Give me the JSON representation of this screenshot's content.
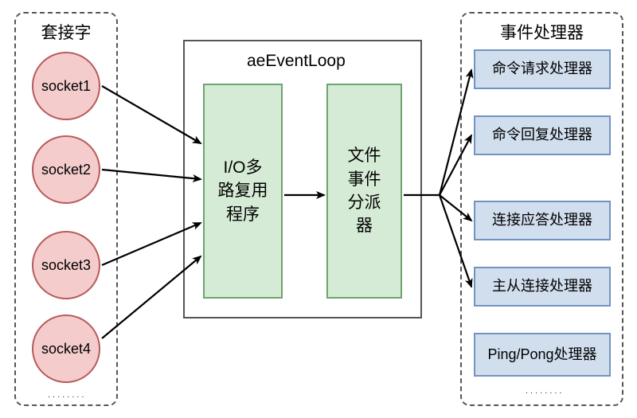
{
  "left_group": {
    "title": "套接字",
    "sockets": [
      "socket1",
      "socket2",
      "socket3",
      "socket4"
    ],
    "ellipsis": "........"
  },
  "center": {
    "title": "aeEventLoop",
    "box_mux": "I/O多路复用程序",
    "box_dispatcher": "文件事件分派器"
  },
  "right_group": {
    "title": "事件处理器",
    "handlers": [
      "命令请求处理器",
      "命令回复处理器",
      "连接应答处理器",
      "主从连接处理器",
      "Ping/Pong处理器"
    ],
    "ellipsis": "........"
  }
}
